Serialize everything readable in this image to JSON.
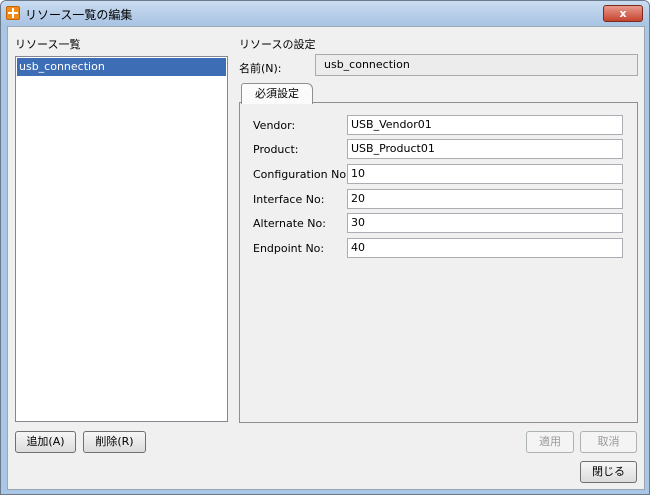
{
  "window": {
    "title": "リソース一覧の編集",
    "close_label": "x"
  },
  "left": {
    "heading": "リソース一覧",
    "items": [
      "usb_connection"
    ],
    "add_label": "追加(A)",
    "delete_label": "削除(R)"
  },
  "right": {
    "heading": "リソースの設定",
    "name_label": "名前(N):",
    "name_value": "usb_connection",
    "tab_label": "必須設定",
    "fields": [
      {
        "label": "Vendor:",
        "value": "USB_Vendor01"
      },
      {
        "label": "Product:",
        "value": "USB_Product01"
      },
      {
        "label": "Configuration No:",
        "value": "10"
      },
      {
        "label": "Interface No:",
        "value": "20"
      },
      {
        "label": "Alternate No:",
        "value": "30"
      },
      {
        "label": "Endpoint No:",
        "value": "40"
      }
    ],
    "apply_label": "適用",
    "cancel_label": "取消",
    "close_label": "閉じる"
  }
}
